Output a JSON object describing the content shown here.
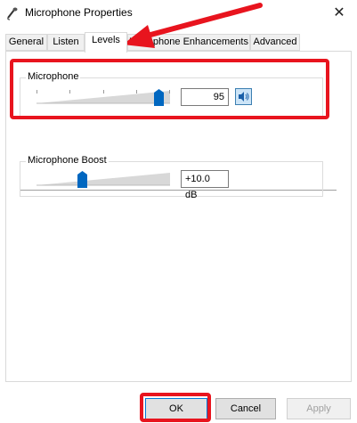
{
  "window": {
    "title": "Microphone Properties",
    "close": "✕"
  },
  "tabs": [
    {
      "label": "General"
    },
    {
      "label": "Listen"
    },
    {
      "label": "Levels"
    },
    {
      "label": "Microphone Enhancements"
    },
    {
      "label": "Advanced"
    }
  ],
  "levels": {
    "microphone": {
      "label": "Microphone",
      "value": "95",
      "level_percent": 95
    },
    "boost": {
      "label": "Microphone Boost",
      "value": "+10.0 dB",
      "level_percent": 33
    }
  },
  "buttons": {
    "ok": "OK",
    "cancel": "Cancel",
    "apply": "Apply"
  },
  "colors": {
    "annotation": "#e8141e",
    "accent": "#0078d7"
  }
}
